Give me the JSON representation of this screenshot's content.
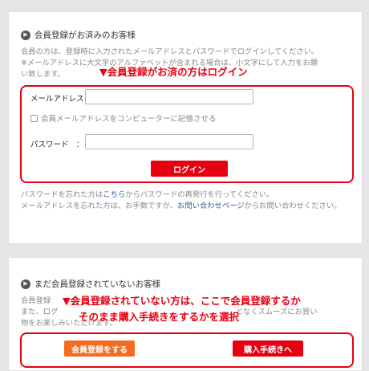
{
  "member_section": {
    "title": "会員登録がお済みのお客様",
    "description_line1": "会員の方は、登録時に入力されたメールアドレスとパスワードでログインしてください。",
    "description_line2": "※メールアドレスに大文字のアルファベットが含まれる場合は、小文字にして入力をお願",
    "description_line3": "い致します。",
    "annotation": "▼会員登録がお済の方はログイン",
    "email_label": "メールアドレス：",
    "email_value": "",
    "remember_label": "会員メールアドレスをコンピューターに記憶させる",
    "password_label": "パスワード　：",
    "password_value": "",
    "login_button": "ログイン",
    "forgot_password_prefix": "パスワードを忘れた方は",
    "forgot_password_link": "こちら",
    "forgot_password_suffix": "からパスワードの再発行を行ってください。",
    "forgot_email_prefix": "メールアドレスを忘れた方は、お手数ですが、",
    "forgot_email_link": "お問い合わせページ",
    "forgot_email_suffix": "からお問い合わせください。"
  },
  "guest_section": {
    "title": "まだ会員登録されていないお客様",
    "desc_line1_fragment": "会員登録",
    "desc_line2_prefix": "また、ログ",
    "desc_line2_suffix": "となくスムーズにお買い",
    "desc_line3": "物をお楽しみいただけます。",
    "annotation_line1": "▼会員登録されていない方は、ここで会員登録するか",
    "annotation_line2": "そのまま購入手続きをするかを選択",
    "register_button": "会員登録をする",
    "purchase_button": "購入手続きへ"
  },
  "colors": {
    "accent_red": "#e60012",
    "register_orange": "#f36c21",
    "link_blue": "#3a5ba0"
  }
}
